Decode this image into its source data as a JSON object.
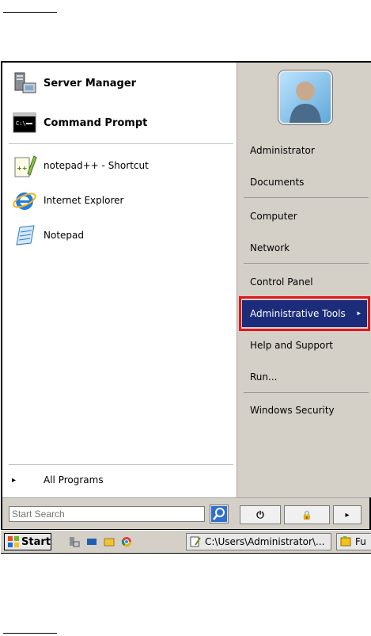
{
  "pinned": [
    {
      "label": "Server Manager",
      "icon": "server-manager-icon"
    },
    {
      "label": "Command Prompt",
      "icon": "command-prompt-icon"
    }
  ],
  "recent": [
    {
      "label": "notepad++ - Shortcut",
      "icon": "notepadplusplus-icon"
    },
    {
      "label": "Internet Explorer",
      "icon": "internet-explorer-icon"
    },
    {
      "label": "Notepad",
      "icon": "notepad-icon"
    }
  ],
  "all_programs": {
    "label": "All Programs",
    "arrow": "▸"
  },
  "right": {
    "items": [
      "Administrator",
      "Documents",
      "Computer",
      "Network",
      "Control Panel",
      "Administrative Tools",
      "Help and Support",
      "Run...",
      "Windows Security"
    ],
    "highlighted": "Administrative Tools",
    "submenu_arrow": "▸"
  },
  "search": {
    "placeholder": "Start Search"
  },
  "power": {
    "power_glyph": "⏻",
    "lock_glyph": "🔒",
    "more_glyph": "▸"
  },
  "taskbar": {
    "start_label": "Start",
    "buttons": [
      {
        "label": "C:\\Users\\Administrator\\..."
      },
      {
        "label": "Fu"
      }
    ]
  },
  "colors": {
    "highlight_bg": "#1b2c7a",
    "annotation": "#e0171b",
    "chrome": "#d4d0c8"
  }
}
